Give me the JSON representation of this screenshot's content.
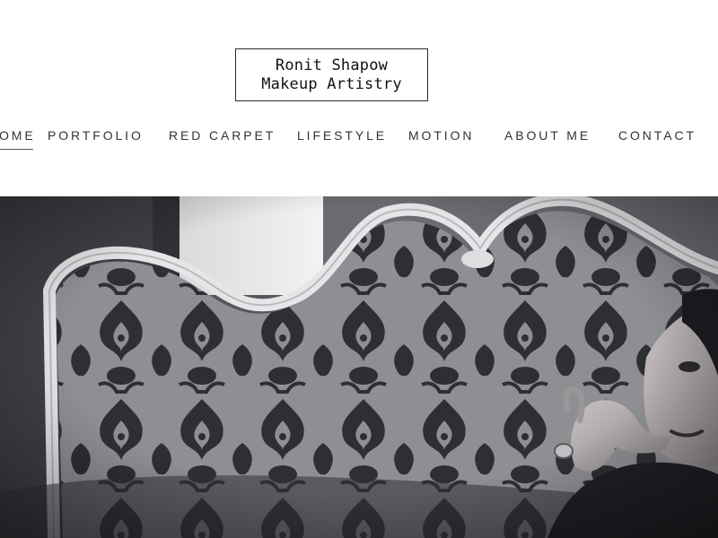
{
  "brand": {
    "line1": "Ronit Shapow",
    "line2": "Makeup Artistry"
  },
  "nav": {
    "items": [
      {
        "label": "HOME",
        "active": true
      },
      {
        "label": "PORTFOLIO",
        "active": false
      },
      {
        "label": "RED CARPET",
        "active": false
      },
      {
        "label": "LIFESTYLE",
        "active": false
      },
      {
        "label": "MOTION",
        "active": false
      },
      {
        "label": "ABOUT ME",
        "active": false
      },
      {
        "label": "CONTACT",
        "active": false
      }
    ]
  },
  "hero": {
    "style": "black-and-white photo",
    "subject": "woman reclining on damask-upholstered sofa with white carved frame"
  },
  "colors": {
    "background": "#ffffff",
    "text": "#333333",
    "border": "#2a2a2a"
  }
}
